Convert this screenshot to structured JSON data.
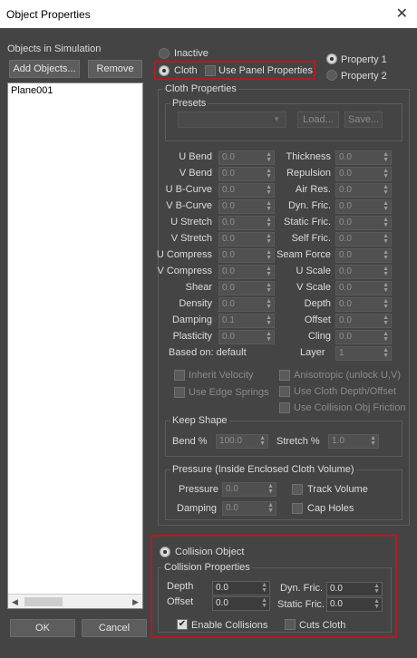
{
  "window": {
    "title": "Object Properties",
    "close": "✕"
  },
  "left": {
    "header": "Objects in Simulation",
    "add_button": "Add Objects...",
    "remove_button": "Remove",
    "items": [
      "Plane001"
    ],
    "ok": "OK",
    "cancel": "Cancel"
  },
  "mode": {
    "inactive": "Inactive",
    "cloth": "Cloth",
    "use_panel": "Use Panel Properties",
    "property1": "Property 1",
    "property2": "Property 2"
  },
  "cloth": {
    "group": "Cloth Properties",
    "presets": "Presets",
    "load": "Load...",
    "save": "Save...",
    "left_params": [
      {
        "label": "U Bend",
        "value": "0.0"
      },
      {
        "label": "V Bend",
        "value": "0.0"
      },
      {
        "label": "U B-Curve",
        "value": "0.0"
      },
      {
        "label": "V B-Curve",
        "value": "0.0"
      },
      {
        "label": "U Stretch",
        "value": "0.0"
      },
      {
        "label": "V Stretch",
        "value": "0.0"
      },
      {
        "label": "U Compress",
        "value": "0.0"
      },
      {
        "label": "V Compress",
        "value": "0.0"
      },
      {
        "label": "Shear",
        "value": "0.0"
      },
      {
        "label": "Density",
        "value": "0.0"
      },
      {
        "label": "Damping",
        "value": "0.1"
      },
      {
        "label": "Plasticity",
        "value": "0.0"
      }
    ],
    "right_params": [
      {
        "label": "Thickness",
        "value": "0.0"
      },
      {
        "label": "Repulsion",
        "value": "0.0"
      },
      {
        "label": "Air Res.",
        "value": "0.0"
      },
      {
        "label": "Dyn. Fric.",
        "value": "0.0"
      },
      {
        "label": "Static Fric.",
        "value": "0.0"
      },
      {
        "label": "Self Fric.",
        "value": "0.0"
      },
      {
        "label": "Seam Force",
        "value": "0.0"
      },
      {
        "label": "U Scale",
        "value": "0.0"
      },
      {
        "label": "V Scale",
        "value": "0.0"
      },
      {
        "label": "Depth",
        "value": "0.0"
      },
      {
        "label": "Offset",
        "value": "0.0"
      },
      {
        "label": "Cling",
        "value": "0.0"
      }
    ],
    "based_on": "Based on: default",
    "layer_label": "Layer",
    "layer_value": "1",
    "inherit_velocity": "Inherit Velocity",
    "use_edge_springs": "Use Edge Springs",
    "anisotropic": "Anisotropic (unlock U,V)",
    "use_cloth_depth": "Use Cloth Depth/Offset",
    "use_collision_obj_friction": "Use Collision Obj Friction",
    "keep_shape": "Keep Shape",
    "bend_label": "Bend %",
    "bend_value": "100.0",
    "stretch_label": "Stretch %",
    "stretch_value": "1.0",
    "pressure_group": "Pressure (Inside Enclosed Cloth Volume)",
    "pressure_label": "Pressure",
    "pressure_value": "0.0",
    "damping_label": "Damping",
    "damping_value": "0.0",
    "track_volume": "Track Volume",
    "cap_holes": "Cap Holes"
  },
  "collision": {
    "title": "Collision Object",
    "group": "Collision Properties",
    "depth_label": "Depth",
    "depth_value": "0.0",
    "offset_label": "Offset",
    "offset_value": "0.0",
    "dyn_label": "Dyn. Fric.",
    "dyn_value": "0.0",
    "static_label": "Static Fric.",
    "static_value": "0.0",
    "enable": "Enable Collisions",
    "cuts": "Cuts Cloth"
  },
  "colors": {
    "highlight": "#b01c25",
    "background": "#444444"
  }
}
